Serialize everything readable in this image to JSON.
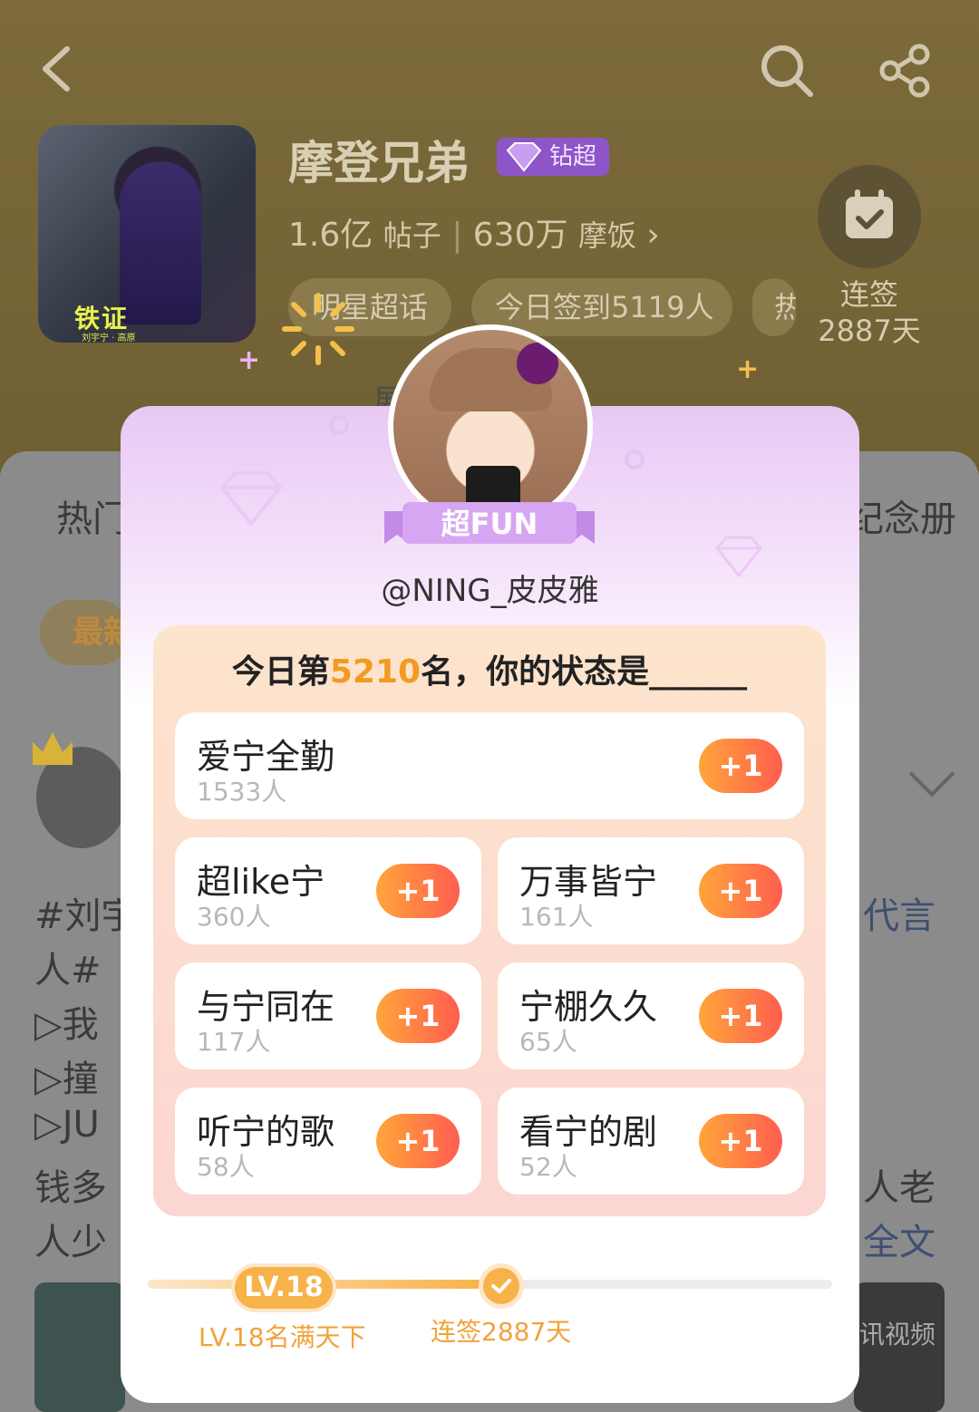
{
  "header": {
    "title": "摩登兄弟",
    "badge": "钻超",
    "cover_text": "铁证",
    "cover_sub": "刘宇宁 · 高原",
    "posts_value": "1.6亿",
    "posts_unit": "帖子",
    "fans_value": "630万",
    "fans_unit": "摩饭",
    "tags": [
      "明星超话",
      "今日签到5119人",
      "热"
    ],
    "checkin_label": "连签",
    "checkin_days": "2887天",
    "fold_text": "展"
  },
  "background": {
    "tab_left": "热门",
    "tab_right": "纪念册",
    "filter": "最新",
    "post_lines_left": [
      "#刘宇",
      "人#",
      "▷我",
      "▷撞",
      "▷JU",
      "钱多",
      "人少"
    ],
    "post_lines_right": [
      "代言",
      "人老",
      "全文"
    ],
    "video_label": "讯视频"
  },
  "modal": {
    "badge_text": "超FUN",
    "username": "@NING_皮皮雅",
    "question_prefix": "今日第",
    "rank": "5210",
    "question_suffix": "名，你的状态是______",
    "options": [
      {
        "label": "爱宁全勤",
        "count": "1533人",
        "action": "+1"
      },
      {
        "label": "超like宁",
        "count": "360人",
        "action": "+1"
      },
      {
        "label": "万事皆宁",
        "count": "161人",
        "action": "+1"
      },
      {
        "label": "与宁同在",
        "count": "117人",
        "action": "+1"
      },
      {
        "label": "宁棚久久",
        "count": "65人",
        "action": "+1"
      },
      {
        "label": "听宁的歌",
        "count": "58人",
        "action": "+1"
      },
      {
        "label": "看宁的剧",
        "count": "52人",
        "action": "+1"
      }
    ],
    "level_badge": "LV.18",
    "level_caption": "LV.18名满天下",
    "streak_caption": "连签2887天",
    "progress_fraction": 0.5
  },
  "colors": {
    "accent_orange": "#f39a22",
    "plus_gradient_start": "#ffa53a",
    "plus_gradient_end": "#ff5e4f",
    "badge_purple": "#8d55c8"
  }
}
